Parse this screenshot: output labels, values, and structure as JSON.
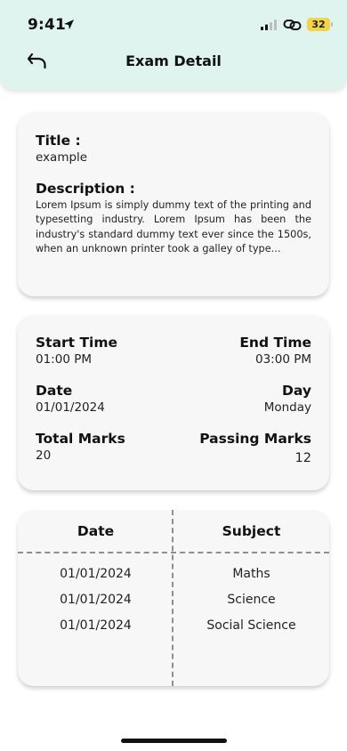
{
  "status_bar": {
    "time": "9:41",
    "battery": "32"
  },
  "header": {
    "title": "Exam Detail"
  },
  "info_card": {
    "title_label": "Title :",
    "title_value": "example",
    "description_label": "Description :",
    "description_value": "Lorem Ipsum is simply dummy text of the printing and typesetting industry. Lorem Ipsum has been the industry's standard dummy text ever since the 1500s, when an unknown printer took a galley of type..."
  },
  "times_card": {
    "start_time_label": "Start Time",
    "start_time_value": "01:00 PM",
    "end_time_label": "End Time",
    "end_time_value": "03:00 PM",
    "date_label": "Date",
    "date_value": "01/01/2024",
    "day_label": "Day",
    "day_value": "Monday",
    "total_marks_label": "Total Marks",
    "total_marks_value": "20",
    "passing_marks_label": "Passing Marks",
    "passing_marks_value": "12"
  },
  "schedule_table": {
    "headers": [
      "Date",
      "Subject"
    ],
    "rows": [
      [
        "01/01/2024",
        "Maths"
      ],
      [
        "01/01/2024",
        "Science"
      ],
      [
        "01/01/2024",
        "Social Science"
      ]
    ]
  },
  "icons": {
    "back": "back-arrow-icon",
    "location": "location-arrow-icon",
    "signal": "signal-bars-icon",
    "link": "link-icon"
  },
  "colors": {
    "header_bg": "#dff3ef",
    "card_bg": "#f7f7f7",
    "battery": "#f3d34a"
  }
}
